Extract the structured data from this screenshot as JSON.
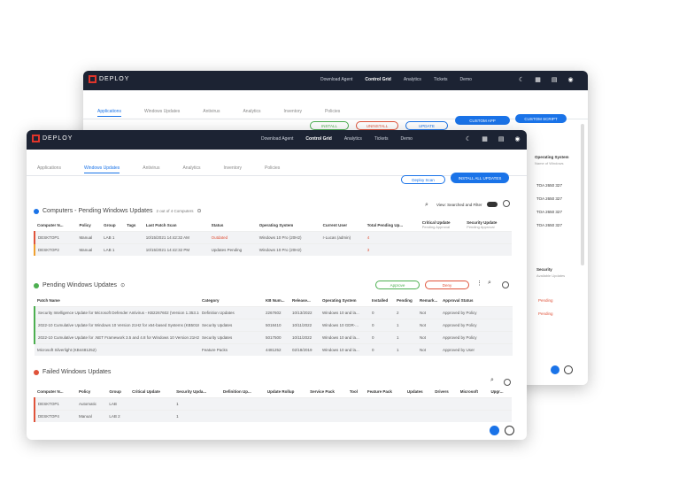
{
  "brand": "DEPLOY",
  "back": {
    "nav": [
      "Download Agent",
      "Control Grid",
      "Analytics",
      "Tickets",
      "Demo"
    ],
    "nav_active": 1,
    "tabs": [
      "Applications",
      "Windows Updates",
      "Antivirus",
      "Analytics",
      "Inventory",
      "Policies"
    ],
    "buttons": [
      "INSTALL",
      "UNINSTALL",
      "UPDATE",
      "CUSTOM APP",
      "CUSTOM SCRIPT"
    ],
    "right_col_header": "Operating System",
    "right_col_sub": "Name of Windows",
    "right_vals": [
      "TOA 2650 327",
      "TOA 2650 327",
      "TOA 2650 327",
      "TOA 2650 327"
    ],
    "security_label": "Security",
    "security_sub": "Available Updates",
    "status_vals": [
      "Pending",
      "Pending"
    ]
  },
  "front": {
    "nav": [
      "Download Agent",
      "Control Grid",
      "Analytics",
      "Tickets",
      "Demo"
    ],
    "nav_active": 1,
    "tabs": [
      "Applications",
      "Windows Updates",
      "Antivirus",
      "Analytics",
      "Inventory",
      "Policies"
    ],
    "tab_active": 1,
    "btn_outline": "Deploy Scan",
    "btn_primary": "INSTALL ALL UPDATES",
    "s1": {
      "title": "Computers - Pending Windows Updates",
      "sub": "2 out of 4 Computers",
      "filter_label": "View: Searched and Filter",
      "cols": [
        "Computer N...",
        "Policy",
        "Group",
        "Tags",
        "Last Patch Scan",
        "Status",
        "Operating System",
        "Current User",
        "Total Pending Up...",
        "Critical Update",
        "Security Update"
      ],
      "col_subs": [
        "Pending Approval",
        "Pending Approval"
      ],
      "rows": [
        [
          "DESKTOP1",
          "Manual",
          "LAB 1",
          "",
          "10/15/2021 14:42:32 AM",
          "Outdated",
          "Windows 10 Pro (20H2)",
          "r-Lucas (admin)",
          "4",
          "",
          ""
        ],
        [
          "DESKTOP2",
          "Manual",
          "LAB 1",
          "",
          "10/15/2021 14:42:32 PM",
          "Updates Pending",
          "Windows 10 Pro (20H2)",
          "",
          "3",
          "",
          ""
        ]
      ]
    },
    "s2": {
      "title": "Pending Windows Updates",
      "btn_approve": "Approve",
      "btn_deny": "Deny",
      "cols": [
        "Patch Name",
        "Category",
        "KB Num...",
        "Release...",
        "Operating System",
        "Installed",
        "Pending",
        "Remark...",
        "Approval Status"
      ],
      "rows": [
        [
          "Security Intelligence Update for Microsoft Defender Antivirus - KB2267602 (Version 1.353.1664.0)",
          "Definition Updates",
          "2267602",
          "10/13/2022",
          "Windows 10 and la...",
          "0",
          "2",
          "Not",
          "Approved by Policy"
        ],
        [
          "2022-10 Cumulative Update for Windows 10 Version 21H2 for x64-based Systems (KB5018410)",
          "Security Updates",
          "5018410",
          "10/11/2022",
          "Windows 10 GDR-...",
          "0",
          "1",
          "Not",
          "Approved by Policy"
        ],
        [
          "2022-10 Cumulative Update for .NET Framework 3.5 and 4.8 for Windows 10 Version 21H2 (KB5017500)",
          "Security Updates",
          "5017500",
          "10/11/2022",
          "Windows 10 and la...",
          "0",
          "1",
          "Not",
          "Approved by Policy"
        ],
        [
          "Microsoft Silverlight (KB4481252)",
          "Feature Packs",
          "4481252",
          "02/18/2019",
          "Windows 10 and la...",
          "0",
          "1",
          "Not",
          "Approved by User"
        ]
      ]
    },
    "s3": {
      "title": "Failed Windows Updates",
      "cols": [
        "Computer N...",
        "Policy",
        "Group",
        "Critical Update",
        "Security Upda...",
        "Definition Up...",
        "Update Rollup",
        "Service Pack",
        "Tool",
        "Feature Pack",
        "Updates",
        "Drivers",
        "Microsoft",
        "Upgr..."
      ],
      "rows": [
        [
          "DESKTOP1",
          "Automatic",
          "LAB",
          "",
          "1",
          "",
          "",
          "",
          "",
          "",
          "",
          "",
          "",
          ""
        ],
        [
          "DESKTOP4",
          "Manual",
          "LAB 2",
          "",
          "1",
          "",
          "",
          "",
          "",
          "",
          "",
          "",
          "",
          ""
        ]
      ]
    }
  }
}
